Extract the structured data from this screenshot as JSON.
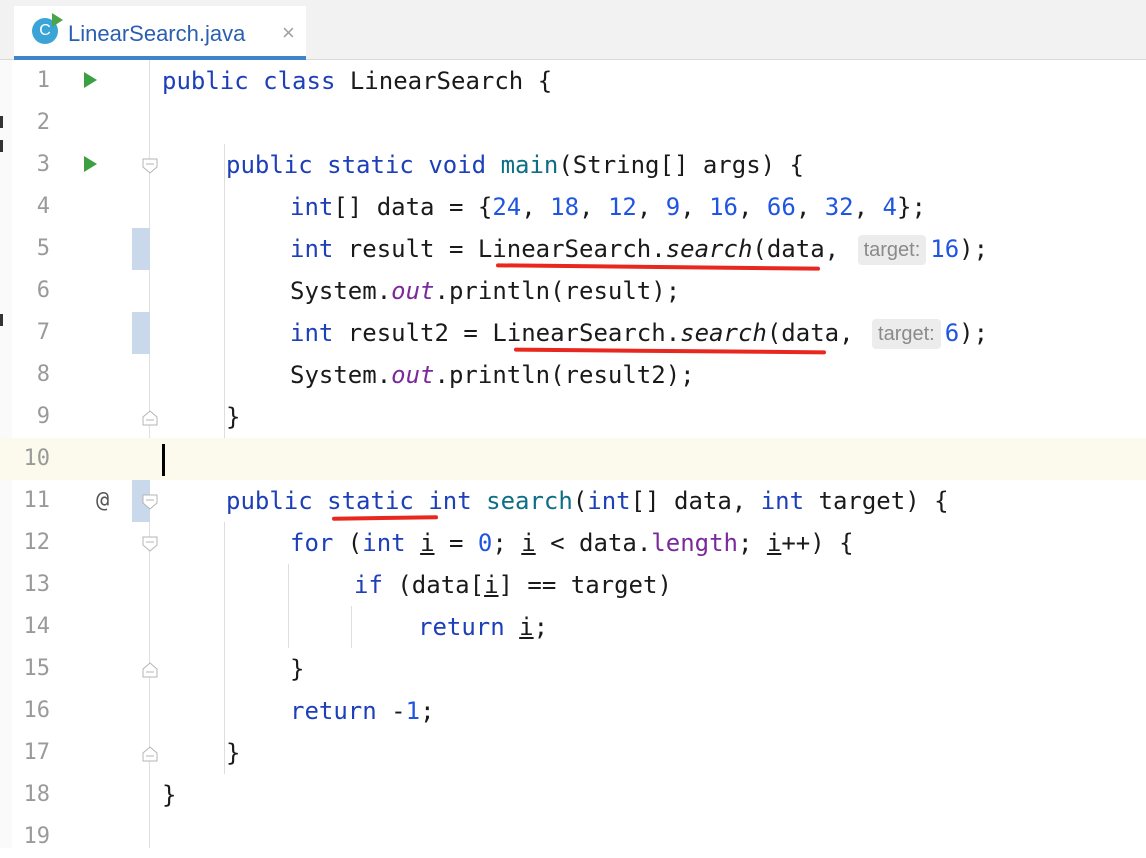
{
  "tab": {
    "icon_letter": "C",
    "title": "LinearSearch.java",
    "close": "×"
  },
  "editor": {
    "line_numbers": [
      "1",
      "2",
      "3",
      "4",
      "5",
      "6",
      "7",
      "8",
      "9",
      "10",
      "11",
      "12",
      "13",
      "14",
      "15",
      "16",
      "17",
      "18",
      "19"
    ],
    "gutter_at": "@",
    "inline_hint": "target:",
    "lines": {
      "l1": {
        "kw_public": "public",
        "kw_class": "class",
        "name": "LinearSearch",
        "brace": " {"
      },
      "l3": {
        "kw_public": "public",
        "kw_static": "static",
        "kw_void": "void",
        "fn_main": "main",
        "rest": "(String[] args) {"
      },
      "l4": {
        "kw_int": "int",
        "a": "[] data = {",
        "n1": "24",
        "n2": "18",
        "n3": "12",
        "n4": "9",
        "n5": "16",
        "n6": "66",
        "n7": "32",
        "n8": "4",
        "end": "};"
      },
      "l5": {
        "kw_int": "int",
        "a": " result = ",
        "cls": "LinearSearch.",
        "method": "search",
        "b": "(data,",
        "arg": "16",
        "end": ");"
      },
      "l6": {
        "a": "System.",
        "field": "out",
        "b": ".println(result);"
      },
      "l7": {
        "kw_int": "int",
        "a": " result2 = ",
        "cls": "LinearSearch.",
        "method": "search",
        "b": "(data,",
        "arg": "6",
        "end": ");"
      },
      "l8": {
        "a": "System.",
        "field": "out",
        "b": ".println(result2);"
      },
      "l9": {
        "brace": "}"
      },
      "l11": {
        "kw_public": "public",
        "kw_static": "static",
        "kw_int": "int",
        "fn": "search",
        "a": "(",
        "kw_int2": "int",
        "b": "[] data, ",
        "kw_int3": "int",
        "c": " target) {"
      },
      "l12": {
        "kw_for": "for",
        "a": " (",
        "kw_int": "int",
        "var_i": "i",
        "b": " = ",
        "n0": "0",
        "c": "; ",
        "var_i2": "i",
        "d": " < data.",
        "field": "length",
        "e": "; ",
        "var_i3": "i",
        "f": "++) {"
      },
      "l13": {
        "kw_if": "if",
        "a": " (data[",
        "var_i": "i",
        "b": "] == target)"
      },
      "l14": {
        "kw_return": "return",
        "sp": " ",
        "var_i": "i",
        "semi": ";"
      },
      "l15": {
        "brace": "}"
      },
      "l16": {
        "kw_return": "return",
        "a": " -",
        "n": "1",
        "semi": ";"
      },
      "l17": {
        "brace": "}"
      },
      "l18": {
        "brace": "}"
      }
    }
  }
}
